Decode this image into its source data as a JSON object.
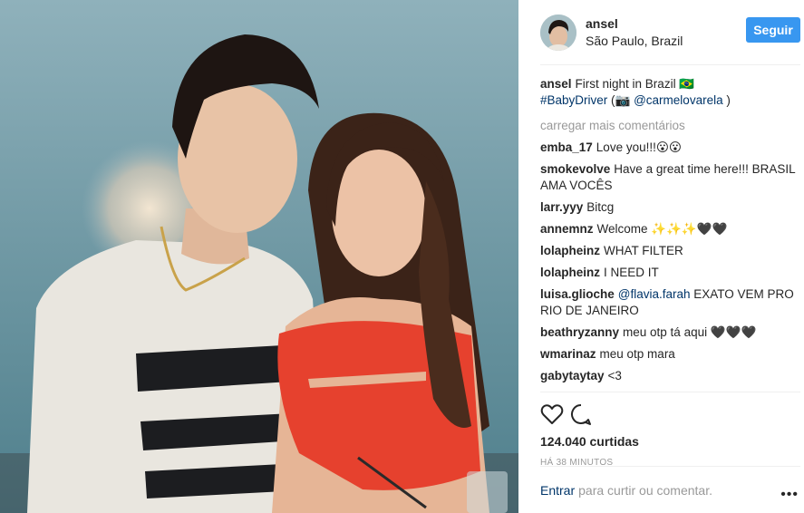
{
  "post": {
    "username": "ansel",
    "location": "São Paulo, Brazil",
    "follow_label": "Seguir",
    "caption": {
      "user": "ansel",
      "text": "First night in Brazil 🇧🇷",
      "hashtag": "#BabyDriver",
      "credit_open": " (📷 ",
      "credit_user": "@carmelovarela",
      "credit_close": " )"
    },
    "load_more": "carregar mais comentários",
    "comments": [
      {
        "user": "emba_17",
        "text": "Love you!!!😮😮"
      },
      {
        "user": "smokevolve",
        "text": "Have a great time here!!! BRASIL AMA VOCÊS"
      },
      {
        "user": "larr.yyy",
        "text": "Bitcg"
      },
      {
        "user": "annemnz",
        "text": "Welcome ✨✨✨🖤🖤"
      },
      {
        "user": "lolapheinz",
        "text": "WHAT FILTER"
      },
      {
        "user": "lolapheinz",
        "text": "I NEED IT"
      },
      {
        "user": "luisa.glioche",
        "mention": "@flavia.farah",
        "text": " EXATO VEM PRO RIO DE JANEIRO"
      },
      {
        "user": "beathryzanny",
        "text": "meu otp tá aqui 🖤🖤🖤"
      },
      {
        "user": "wmarinaz",
        "text": "meu otp mara"
      },
      {
        "user": "gabytaytay",
        "text": "<3"
      }
    ],
    "likes": "124.040 curtidas",
    "timestamp": "HÁ 38 MINUTOS",
    "add_comment": {
      "enter": "Entrar",
      "rest": "para curtir ou comentar."
    },
    "more_icon": "•••"
  },
  "icons": {
    "like": "heart-icon",
    "comment": "comment-bubble-icon",
    "options": "ellipsis-icon"
  },
  "colors": {
    "accent": "#3897f0",
    "link": "#003569",
    "muted": "#999999",
    "text": "#262626"
  }
}
